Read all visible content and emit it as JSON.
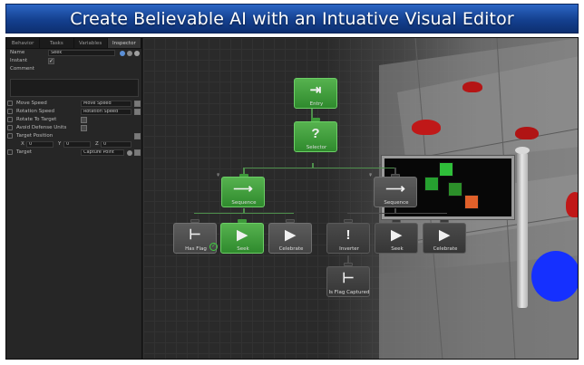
{
  "banner": {
    "title": "Create Believable AI with an Intuative Visual Editor"
  },
  "inspector": {
    "tabs": [
      {
        "label": "Behavior",
        "active": false
      },
      {
        "label": "Tasks",
        "active": false
      },
      {
        "label": "Variables",
        "active": false
      },
      {
        "label": "Inspector",
        "active": true
      }
    ],
    "name_label": "Name",
    "name_value": "Seek",
    "instant_label": "Instant",
    "instant_checked": true,
    "comment_label": "Comment",
    "move_speed_label": "Move Speed",
    "move_speed_value": "Move Speed",
    "rotation_speed_label": "Rotation Speed",
    "rotation_speed_value": "Rotation Speed",
    "rotate_to_target_label": "Rotate To Target",
    "avoid_defense_units_label": "Avoid Defense Units",
    "target_position_label": "Target Position",
    "x_label": "X",
    "x_value": "0",
    "y_label": "Y",
    "y_value": "0",
    "z_label": "Z",
    "z_value": "0",
    "target_label": "Target",
    "target_value": "Capture Point"
  },
  "graph": {
    "nodes": {
      "entry": "Entry",
      "selector": "Selector",
      "sequence_left": "Sequence",
      "sequence_right": "Sequence",
      "has_flag": "Has Flag",
      "seek_left": "Seek",
      "celebrate_left": "Celebrate",
      "inverter": "Inverter",
      "seek_right": "Seek",
      "celebrate_right": "Celebrate",
      "is_flag_captured": "Is Flag Captured"
    }
  },
  "colors": {
    "banner": "#1b4da6",
    "active_node": "#3f9c3b",
    "inactive_node": "#4f4f4f",
    "unit_red": "#c01818",
    "unit_blue": "#1530ff"
  }
}
